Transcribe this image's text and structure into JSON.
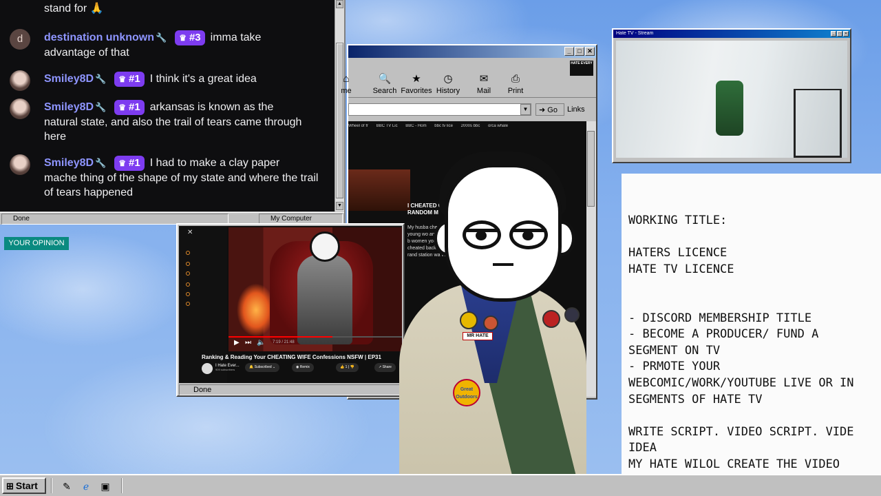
{
  "chat": {
    "partial_top": "stand for 🙏",
    "messages": [
      {
        "avatar": "d",
        "user": "destination unknown",
        "badge": "#3",
        "text_first": "imma take",
        "text_rest": "advantage of that"
      },
      {
        "avatar": "",
        "user": "Smiley8D",
        "badge": "#1",
        "text_first": "I think it's a great idea",
        "text_rest": ""
      },
      {
        "avatar": "",
        "user": "Smiley8D",
        "badge": "#1",
        "text_first": "arkansas is known as the",
        "text_rest": "natural state, and also the trail of tears came through here"
      },
      {
        "avatar": "",
        "user": "Smiley8D",
        "badge": "#1",
        "text_first": "I had to make a clay paper",
        "text_rest": "mache thing of the shape of my state and where the trail of tears happened"
      }
    ],
    "status_left": "Done",
    "status_right": "My Computer"
  },
  "opinion_label": "YOUR OPINION",
  "ie": {
    "tools": [
      {
        "icon": "search-icon",
        "label": "Search"
      },
      {
        "icon": "favorites-icon",
        "label": "Favorites"
      },
      {
        "icon": "history-icon",
        "label": "History"
      },
      {
        "icon": "mail-icon",
        "label": "Mail"
      },
      {
        "icon": "print-icon",
        "label": "Print"
      }
    ],
    "partial_tool": "me",
    "go_label": "Go",
    "links_label": "Links",
    "logo_text": "HATE EVERY",
    "tabs": [
      "Wheel of fr",
      "BBC TV Lic",
      "BBC - Hom",
      "bbc tv lice",
      "2000s bbc",
      "orca whale"
    ],
    "post_title": "I CHEATED ON I RANDOM M",
    "post_body": "My husba cheating young wo and he has b women young a I cheated back with a rand station wa very"
  },
  "youtube": {
    "video_title": "Ranking & Reading Your CHEATING WIFE Confessions NSFW | EP31",
    "channel": "I Hate Ever...",
    "subscribers": "909 subscribers",
    "subscribed_label": "Subscribed",
    "remix_label": "Remix",
    "likes": "1",
    "share_label": "Share",
    "time": "7:19 / 21:48",
    "status": "Done",
    "progress": 0.6
  },
  "stream": {
    "title": "Hate TV - Stream"
  },
  "character": {
    "name_tag": "MR HATE",
    "badge_text": "Great Outdoors"
  },
  "notes": {
    "lines": [
      "WORKING TITLE:",
      "",
      "HATERS LICENCE",
      "HATE TV LICENCE",
      "",
      "",
      "- DISCORD MEMBERSHIP TITLE",
      "- BECOME A PRODUCER/ FUND A",
      "SEGMENT ON TV",
      "- PRMOTE YOUR",
      "WEBCOMIC/WORK/YOUTUBE LIVE OR IN",
      "SEGMENTS OF HATE TV",
      "",
      "WRITE SCRIPT. VIDEO SCRIPT. VIDE",
      "IDEA",
      "MY HATE WILOL CREATE THE VIDEO"
    ]
  },
  "taskbar": {
    "start_label": "Start"
  }
}
